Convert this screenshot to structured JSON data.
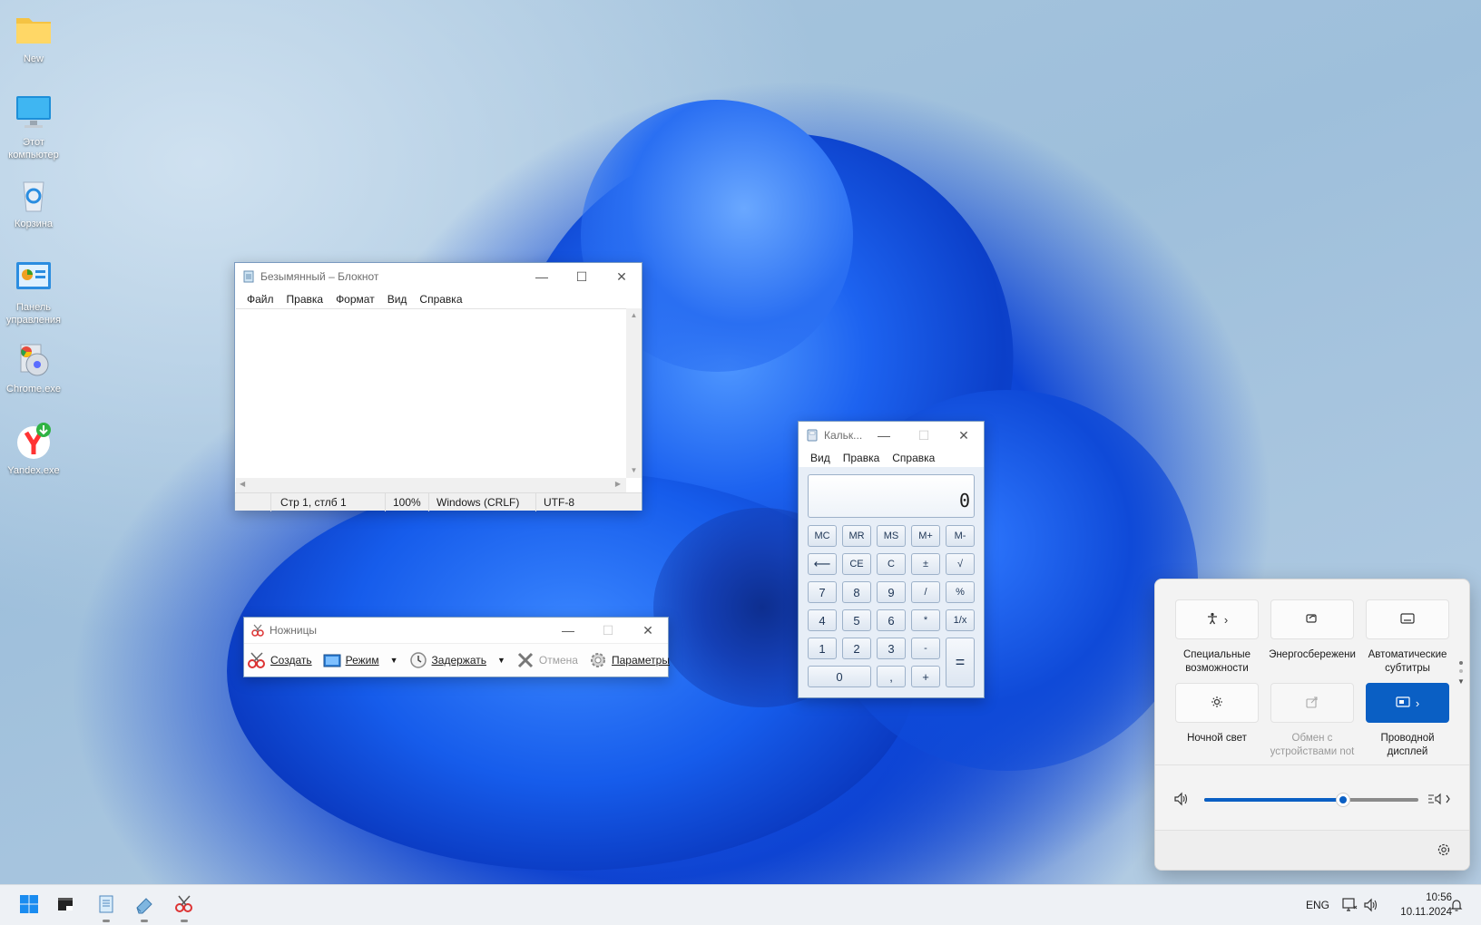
{
  "desktop": {
    "icons": [
      {
        "label": "New",
        "icon": "folder-icon"
      },
      {
        "label": "Этот компьютер",
        "icon": "monitor-icon"
      },
      {
        "label": "Корзина",
        "icon": "recycle-bin-icon"
      },
      {
        "label": "Панель управления",
        "icon": "control-panel-icon"
      },
      {
        "label": "Chrome.exe",
        "icon": "chrome-installer-icon"
      },
      {
        "label": "Yandex.exe",
        "icon": "yandex-icon"
      }
    ]
  },
  "notepad": {
    "title": "Безымянный – Блокнот",
    "menu": [
      "Файл",
      "Правка",
      "Формат",
      "Вид",
      "Справка"
    ],
    "content": "",
    "status": {
      "position": "Стр 1, стлб 1",
      "zoom": "100%",
      "line_ending": "Windows (CRLF)",
      "encoding": "UTF-8"
    }
  },
  "calculator": {
    "title": "Кальк...",
    "menu": [
      "Вид",
      "Правка",
      "Справка"
    ],
    "display": "0",
    "keys": {
      "mc": "MC",
      "mr": "MR",
      "ms": "MS",
      "mplus": "M+",
      "mminus": "M-",
      "back": "⟵",
      "ce": "CE",
      "c": "C",
      "sign": "±",
      "sqrt": "√",
      "k7": "7",
      "k8": "8",
      "k9": "9",
      "div": "/",
      "pct": "%",
      "k4": "4",
      "k5": "5",
      "k6": "6",
      "mul": "*",
      "inv": "1/x",
      "k1": "1",
      "k2": "2",
      "k3": "3",
      "sub": "-",
      "k0": "0",
      "dec": ",",
      "add": "+",
      "eq": "="
    }
  },
  "snipping": {
    "title": "Ножницы",
    "tools": {
      "new": "Создать",
      "mode": "Режим",
      "delay": "Задержать",
      "cancel": "Отмена",
      "options": "Параметры"
    }
  },
  "quick_settings": {
    "tiles": [
      {
        "label": "Специальные возможности",
        "icon": "accessibility-icon",
        "active": false
      },
      {
        "label": "Энергосбережени",
        "icon": "energy-saver-icon",
        "active": false
      },
      {
        "label": "Автоматические субтитры",
        "icon": "captions-icon",
        "active": false
      },
      {
        "label": "Ночной свет",
        "icon": "night-light-icon",
        "active": false
      },
      {
        "label": "Обмен с устройствами not",
        "icon": "share-icon",
        "active": false
      },
      {
        "label": "Проводной дисплей",
        "icon": "cast-icon",
        "active": true
      }
    ],
    "volume": 0.65,
    "accent_color": "#0a5fc4"
  },
  "taskbar": {
    "language": "ENG",
    "time": "10:56",
    "date": "10.11.2024",
    "apps": [
      "windows-start-icon",
      "terminal-icon",
      "notepad-icon",
      "eraser-icon",
      "snipping-tool-icon"
    ]
  }
}
